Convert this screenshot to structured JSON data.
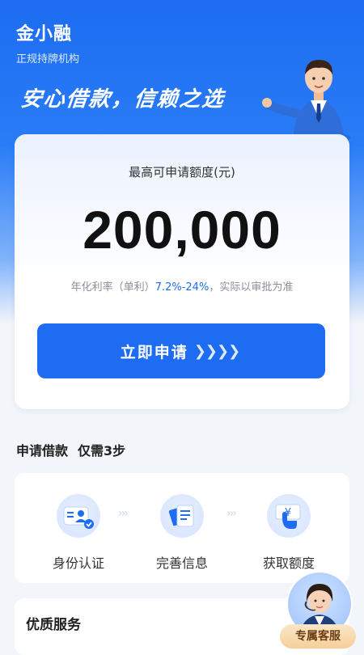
{
  "header": {
    "brand": "金小融",
    "subtitle": "正规持牌机构",
    "slogan": "安心借款，信赖之选"
  },
  "loan_card": {
    "limit_label": "最高可申请额度(元)",
    "amount": "200,000",
    "rate_prefix": "年化利率（单利）",
    "rate_value": "7.2%-24%",
    "rate_suffix": "，实际以审批为准",
    "apply_label": "立即申请"
  },
  "steps": {
    "title_main": "申请借款",
    "title_sub": "仅需3步",
    "items": [
      {
        "label": "身份认证",
        "icon": "id-verify-icon"
      },
      {
        "label": "完善信息",
        "icon": "document-info-icon"
      },
      {
        "label": "获取额度",
        "icon": "yen-quota-icon"
      }
    ]
  },
  "services": {
    "title": "优质服务"
  },
  "customer_service": {
    "label": "专属客服"
  },
  "colors": {
    "brand_blue": "#1d6cf2",
    "cs_gold": "#f5cf99"
  }
}
